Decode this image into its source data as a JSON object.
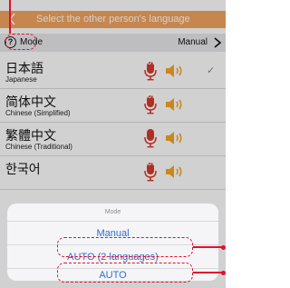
{
  "header": {
    "title": "Select the other person's language"
  },
  "mode_bar": {
    "help_glyph": "?",
    "label": "Mode",
    "value": "Manual"
  },
  "languages": [
    {
      "name": "日本語",
      "sub": "Japanese",
      "mic": "auto",
      "selected": true
    },
    {
      "name": "简体中文",
      "sub": "Chinese (Simplified)",
      "mic": "auto",
      "selected": false
    },
    {
      "name": "繁體中文",
      "sub": "Chinese (Traditional)",
      "mic": "plain",
      "selected": false
    },
    {
      "name": "한국어",
      "sub": "",
      "mic": "auto",
      "selected": false
    }
  ],
  "auto_badge": "AUTO",
  "check_glyph": "✓",
  "sheet": {
    "title": "Mode",
    "options": [
      "Manual",
      "AUTO (2 languages)",
      "AUTO"
    ]
  },
  "colors": {
    "header": "#f3a45f",
    "mic": "#d9392b",
    "speaker": "#f6a623",
    "option_text": "#2c6fd8",
    "annotation": "#e0102d"
  }
}
